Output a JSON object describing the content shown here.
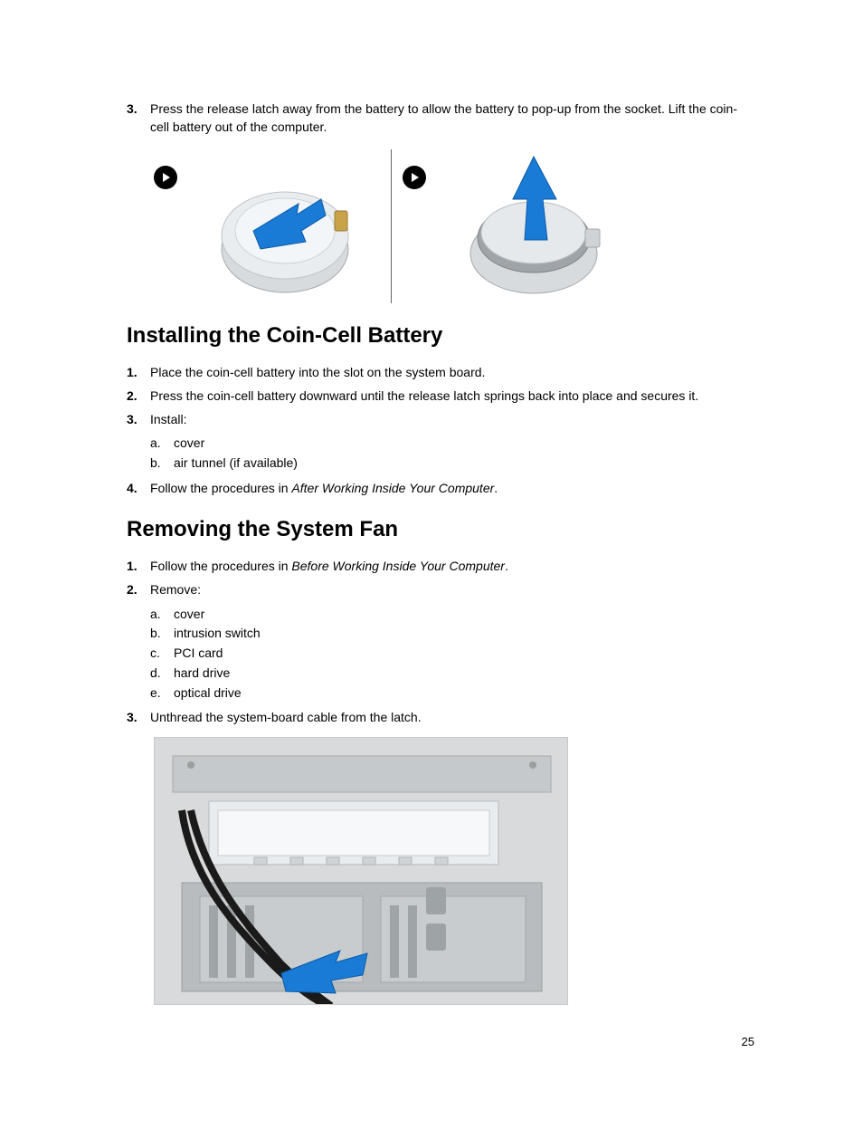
{
  "step3": {
    "num": "3.",
    "text": "Press the release latch away from the battery to allow the battery to pop-up from the socket. Lift the coin-cell battery out of the computer."
  },
  "heading_install": "Installing the Coin-Cell Battery",
  "install": {
    "s1": {
      "num": "1.",
      "text": "Place the coin-cell battery into the slot on the system board."
    },
    "s2": {
      "num": "2.",
      "text": "Press the coin-cell battery downward until the release latch springs back into place and secures it."
    },
    "s3": {
      "num": "3.",
      "text": "Install:"
    },
    "s3a": {
      "letter": "a.",
      "text": "cover"
    },
    "s3b": {
      "letter": "b.",
      "text": "air tunnel (if available)"
    },
    "s4": {
      "num": "4.",
      "prefix": "Follow the procedures in ",
      "italic": "After Working Inside Your Computer",
      "suffix": "."
    }
  },
  "heading_remove": "Removing the System Fan",
  "remove": {
    "s1": {
      "num": "1.",
      "prefix": "Follow the procedures in ",
      "italic": "Before Working Inside Your Computer",
      "suffix": "."
    },
    "s2": {
      "num": "2.",
      "text": "Remove:"
    },
    "s2a": {
      "letter": "a.",
      "text": "cover"
    },
    "s2b": {
      "letter": "b.",
      "text": "intrusion switch"
    },
    "s2c": {
      "letter": "c.",
      "text": "PCI card"
    },
    "s2d": {
      "letter": "d.",
      "text": "hard drive"
    },
    "s2e": {
      "letter": "e.",
      "text": "optical drive"
    },
    "s3": {
      "num": "3.",
      "text": "Unthread the system-board cable from the latch."
    }
  },
  "page_number": "25"
}
